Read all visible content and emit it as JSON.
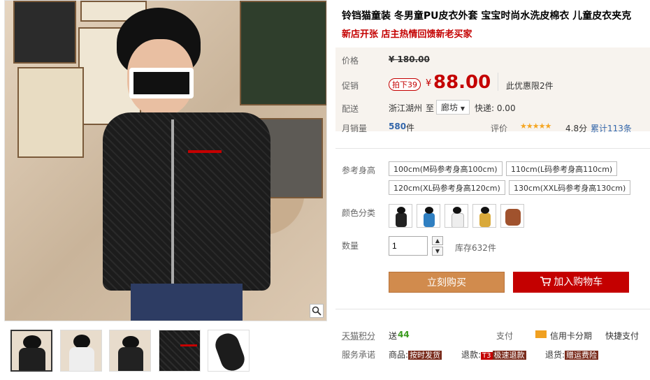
{
  "product": {
    "title": "铃铛猫童装 冬男童PU皮衣外套 宝宝时尚水洗皮棉衣 儿童皮衣夹克",
    "promo": "新店开张 店主热情回馈新老买家"
  },
  "price": {
    "label": "价格",
    "original": "¥ 180.00",
    "promo_label": "促销",
    "tag": "拍下39",
    "currency": "¥",
    "value": "88.00",
    "limit": "此优惠限2件"
  },
  "delivery": {
    "label": "配送",
    "from": "浙江湖州",
    "to_word": "至",
    "to": "廊坊",
    "express": "快递: 0.00"
  },
  "sales": {
    "label": "月销量",
    "count": "580",
    "unit": "件",
    "rating_label": "评价",
    "stars": "★★★★★",
    "score": "4.8分",
    "reviews": "累计113条"
  },
  "size": {
    "label": "参考身高",
    "options": [
      "100cm(M码参考身高100cm)",
      "110cm(L码参考身高110cm)",
      "120cm(XL码参考身高120cm)",
      "130cm(XXL码参考身高130cm)"
    ]
  },
  "color": {
    "label": "颜色分类"
  },
  "quantity": {
    "label": "数量",
    "value": "1",
    "stock": "库存632件"
  },
  "actions": {
    "buy": "立刻购买",
    "cart": "加入购物车"
  },
  "points": {
    "label": "天猫积分",
    "send": "送",
    "amount": "44",
    "pay_label": "支付",
    "credit": "信用卡分期",
    "quick": "快捷支付"
  },
  "service": {
    "label": "服务承诺",
    "goods": "商品:",
    "goods_badge": "按时发货",
    "refund": "退款:",
    "refund_t3": "T3",
    "refund_badge": "极速退款",
    "return": "退货:",
    "return_badge": "赠运费险"
  },
  "colors": {
    "accent": "#c40000",
    "buy": "#d18b4d"
  }
}
